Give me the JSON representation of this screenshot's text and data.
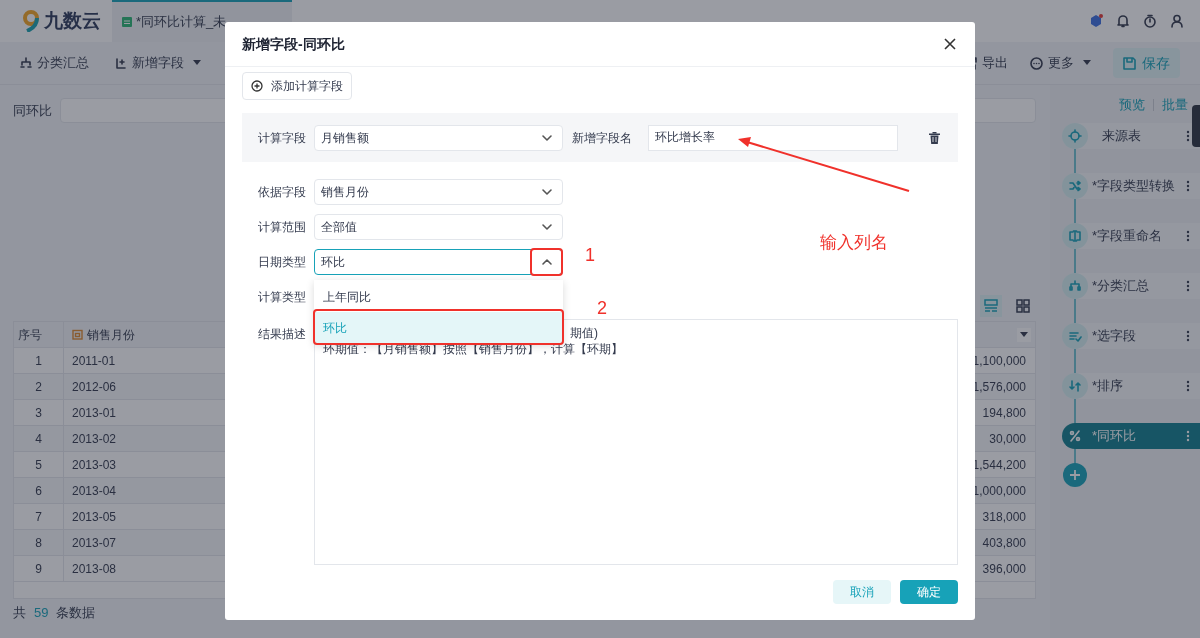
{
  "app": {
    "logo": "九数云",
    "tab": "*同环比计算_未"
  },
  "toolbar": {
    "left": [
      {
        "label": "分类汇总",
        "dropdown": false
      },
      {
        "label": "新增字段",
        "dropdown": true
      }
    ],
    "right": [
      {
        "label": "导出",
        "dropdown": false
      },
      {
        "label": "更多",
        "dropdown": true
      }
    ],
    "save": "保存"
  },
  "filter": {
    "label": "同环比"
  },
  "panel": {
    "links": [
      "预览",
      "批量"
    ],
    "steps": [
      {
        "label": "来源表",
        "selected": false
      },
      {
        "label": "*字段类型转换",
        "selected": false
      },
      {
        "label": "*字段重命名",
        "selected": false
      },
      {
        "label": "*分类汇总",
        "selected": false
      },
      {
        "label": "*选字段",
        "selected": false
      },
      {
        "label": "*排序",
        "selected": false
      },
      {
        "label": "*同环比",
        "selected": true
      }
    ]
  },
  "table": {
    "columns": [
      "序号",
      "销售月份"
    ],
    "rows": [
      {
        "index": "1",
        "month": "2011-01",
        "value": "1,100,000"
      },
      {
        "index": "2",
        "month": "2012-06",
        "value": "1,576,000"
      },
      {
        "index": "3",
        "month": "2013-01",
        "value": "194,800"
      },
      {
        "index": "4",
        "month": "2013-02",
        "value": "30,000"
      },
      {
        "index": "5",
        "month": "2013-03",
        "value": "1,544,200"
      },
      {
        "index": "6",
        "month": "2013-04",
        "value": "1,000,000"
      },
      {
        "index": "7",
        "month": "2013-05",
        "value": "318,000"
      },
      {
        "index": "8",
        "month": "2013-07",
        "value": "403,800"
      },
      {
        "index": "9",
        "month": "2013-08",
        "value": "396,000"
      }
    ],
    "footer": {
      "prefix": "共",
      "count": "59",
      "suffix": "条数据"
    }
  },
  "dialog": {
    "title": "新增字段-同环比",
    "add_button": "添加计算字段",
    "calc_field": {
      "label": "计算字段",
      "value": "月销售额"
    },
    "new_name": {
      "label": "新增字段名",
      "value": "环比增长率"
    },
    "selects": [
      {
        "label": "依据字段",
        "value": "销售月份",
        "expanded": false
      },
      {
        "label": "计算范围",
        "value": "全部值",
        "expanded": false
      },
      {
        "label": "日期类型",
        "value": "环比",
        "expanded": true
      }
    ],
    "calc_type_label": "计算类型",
    "description_label": "结果描述",
    "options": [
      {
        "label": "上年同比",
        "selected": false
      },
      {
        "label": "环比",
        "selected": true
      }
    ],
    "description": [
      "期值)",
      "环期值：【月销售额】按照【销售月份】，计算【环期】"
    ],
    "cancel": "取消",
    "ok": "确定"
  },
  "annotations": [
    {
      "kind": "number",
      "text": "1"
    },
    {
      "kind": "number",
      "text": "2"
    },
    {
      "kind": "note",
      "text": "输入列名"
    }
  ]
}
